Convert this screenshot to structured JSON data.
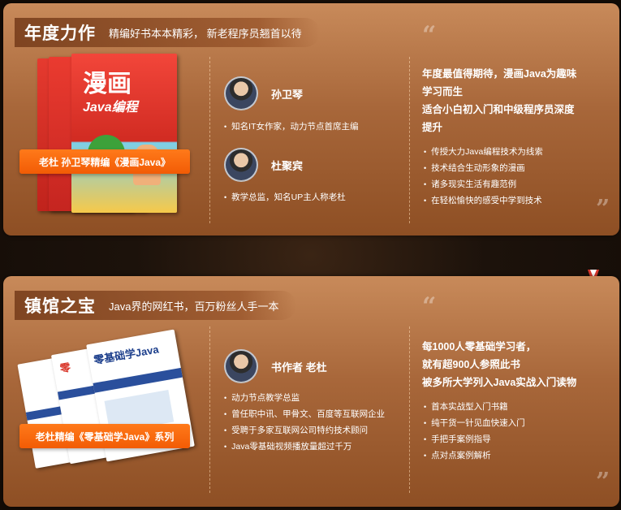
{
  "card1": {
    "title": "年度力作",
    "subtitle": "精编好书本本精彩， 新老程序员翘首以待",
    "book_cover_title": "漫画",
    "book_cover_sub": "Java编程",
    "badge": "老杜 孙卫琴精编《漫画Java》",
    "authors": [
      {
        "name": "孙卫琴",
        "desc": "知名IT女作家，动力节点首席主编"
      },
      {
        "name": "杜聚宾",
        "desc": "教学总监，知名UP主人称老杜"
      }
    ],
    "headline": [
      "年度最值得期待，漫画Java为趣味",
      "学习而生",
      "适合小白初入门和中级程序员深度",
      "提升"
    ],
    "features": [
      "传授大力Java编程技术为线索",
      "技术结合生动形象的漫画",
      "诸多现实生活有趣范例",
      "在轻松愉快的感受中学到技术"
    ]
  },
  "card2": {
    "title": "镇馆之宝",
    "subtitle": "Java界的网红书，百万粉丝人手一本",
    "book_cover_title": "零基础学Java",
    "badge": "老杜精编《零基础学Java》系列",
    "authors": [
      {
        "name": "书作者 老杜"
      }
    ],
    "author_points": [
      "动力节点教学总监",
      "曾任职中讯、甲骨文、百度等互联网企业",
      "受聘于多家互联网公司特约技术顾问",
      "Java零基础视频播放量超过千万"
    ],
    "headline": [
      "每1000人零基础学习者，",
      "就有超900人参照此书",
      "被多所大学列入Java实战入门读物"
    ],
    "features": [
      "首本实战型入门书籍",
      "纯干货一针见血快速入门",
      "手把手案例指导",
      "点对点案例解析"
    ]
  },
  "colors": {
    "accent": "#f25c05",
    "card_top": "#c88a5a",
    "card_bottom": "#8e4f24"
  }
}
